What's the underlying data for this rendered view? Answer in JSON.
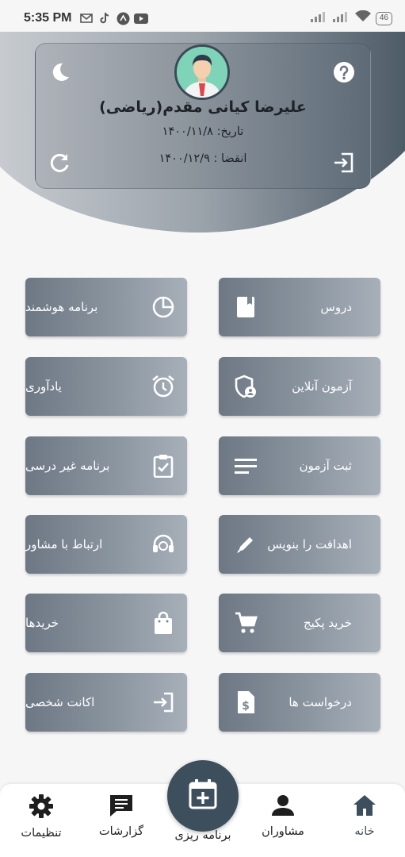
{
  "status_bar": {
    "time": "5:35 PM",
    "battery": "46"
  },
  "profile": {
    "name": "علیرضا کیانی مقدم(ریاضی)",
    "date": "تاریخ: ۱۴۰۰/۱۱/۸",
    "expire": "انقضا : ۱۴۰۰/۱۲/۹",
    "icons": [
      "moon-icon",
      "help-icon",
      "refresh-icon",
      "logout-icon"
    ]
  },
  "menu": {
    "right": [
      {
        "label": "دروس",
        "icon": "book-icon"
      },
      {
        "label": "آزمون آنلاین",
        "icon": "shield-user-icon"
      },
      {
        "label": "ثبت آزمون",
        "icon": "lines-icon"
      },
      {
        "label": "اهدافت را بنویس",
        "icon": "pen-icon"
      },
      {
        "label": "خرید پکیج",
        "icon": "cart-icon"
      },
      {
        "label": "درخواست ها",
        "icon": "document-dollar-icon"
      }
    ],
    "left": [
      {
        "label": "برنامه هوشمند",
        "icon": "pie-chart-icon"
      },
      {
        "label": "یادآوری",
        "icon": "alarm-icon"
      },
      {
        "label": "برنامه غیر درسی",
        "icon": "clipboard-check-icon"
      },
      {
        "label": "ارتباط با مشاور",
        "icon": "headset-icon"
      },
      {
        "label": "خریدها",
        "icon": "shopping-bag-icon"
      },
      {
        "label": "اکانت شخصی",
        "icon": "login-icon"
      }
    ]
  },
  "bottom_nav": {
    "home": "خانه",
    "advisors": "مشاوران",
    "planning": "برنامه ریزی",
    "reports": "گزارشات",
    "settings": "تنظیمات"
  },
  "colors": {
    "accent": "#3d4f5c",
    "tile_dark": "#6d7884",
    "tile_light": "#a7b0b9",
    "avatar_bg": "#7fd3b8"
  }
}
